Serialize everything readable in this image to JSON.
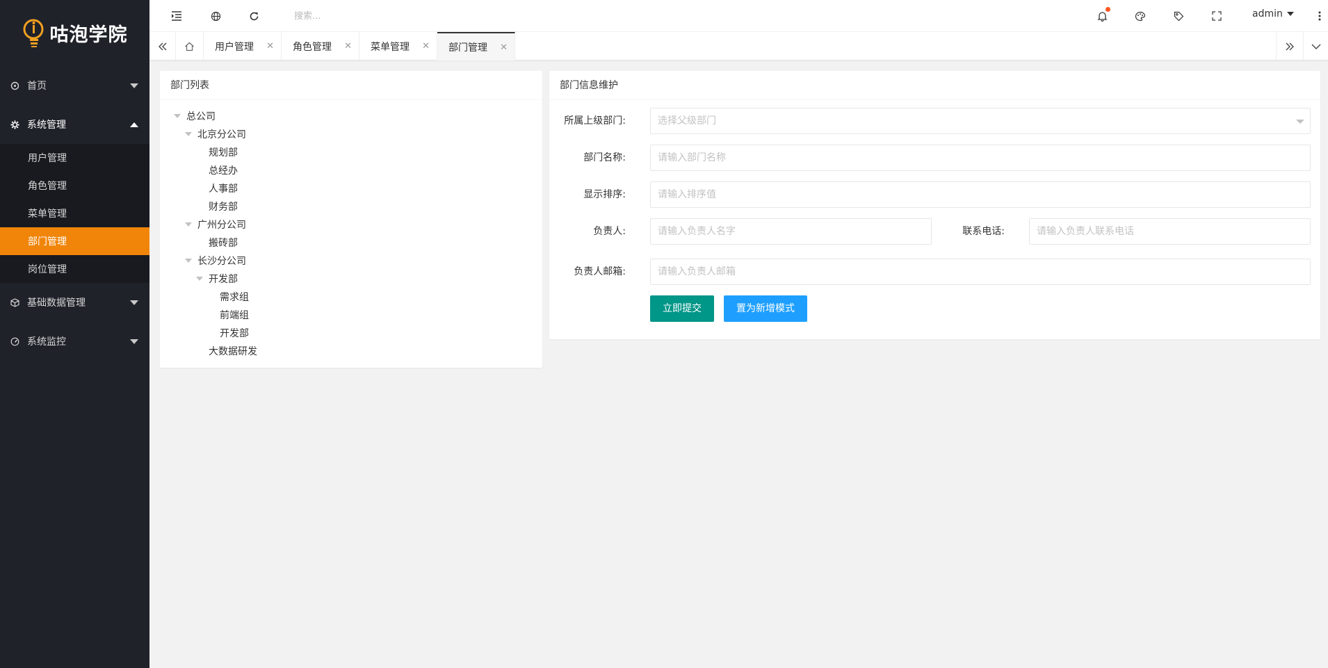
{
  "app": {
    "logo_text": "咕泡学院"
  },
  "colors": {
    "accent": "#f0850a",
    "sidebar_bg": "#20222a",
    "submit_btn": "#009688",
    "new_mode_btn": "#1e9fff"
  },
  "sidebar": {
    "items": [
      {
        "label": "首页",
        "icon": "home-icon"
      },
      {
        "label": "系统管理",
        "icon": "gear-icon"
      },
      {
        "label": "基础数据管理",
        "icon": "cube-icon"
      },
      {
        "label": "系统监控",
        "icon": "gauge-icon"
      }
    ],
    "system_submenu": [
      {
        "label": "用户管理"
      },
      {
        "label": "角色管理"
      },
      {
        "label": "菜单管理"
      },
      {
        "label": "部门管理",
        "active": true
      },
      {
        "label": "岗位管理"
      }
    ]
  },
  "header": {
    "search_placeholder": "搜索...",
    "user": "admin"
  },
  "tabs": [
    {
      "label": "用户管理"
    },
    {
      "label": "角色管理"
    },
    {
      "label": "菜单管理"
    },
    {
      "label": "部门管理",
      "active": true
    }
  ],
  "dept_list": {
    "title": "部门列表",
    "nodes": [
      {
        "label": "总公司"
      },
      {
        "label": "北京分公司"
      },
      {
        "label": "规划部"
      },
      {
        "label": "总经办"
      },
      {
        "label": "人事部"
      },
      {
        "label": "财务部"
      },
      {
        "label": "广州分公司"
      },
      {
        "label": "搬砖部"
      },
      {
        "label": "长沙分公司"
      },
      {
        "label": "开发部"
      },
      {
        "label": "需求组"
      },
      {
        "label": "前端组"
      },
      {
        "label": "开发部"
      },
      {
        "label": "大数据研发"
      }
    ]
  },
  "dept_form": {
    "title": "部门信息维护",
    "parent_label": "所属上级部门:",
    "parent_placeholder": "选择父级部门",
    "name_label": "部门名称:",
    "name_placeholder": "请输入部门名称",
    "order_label": "显示排序:",
    "order_placeholder": "请输入排序值",
    "leader_label": "负责人:",
    "leader_placeholder": "请输入负责人名字",
    "phone_label": "联系电话:",
    "phone_placeholder": "请输入负责人联系电话",
    "email_label": "负责人邮箱:",
    "email_placeholder": "请输入负责人邮箱",
    "submit_label": "立即提交",
    "new_mode_label": "置为新增模式"
  }
}
